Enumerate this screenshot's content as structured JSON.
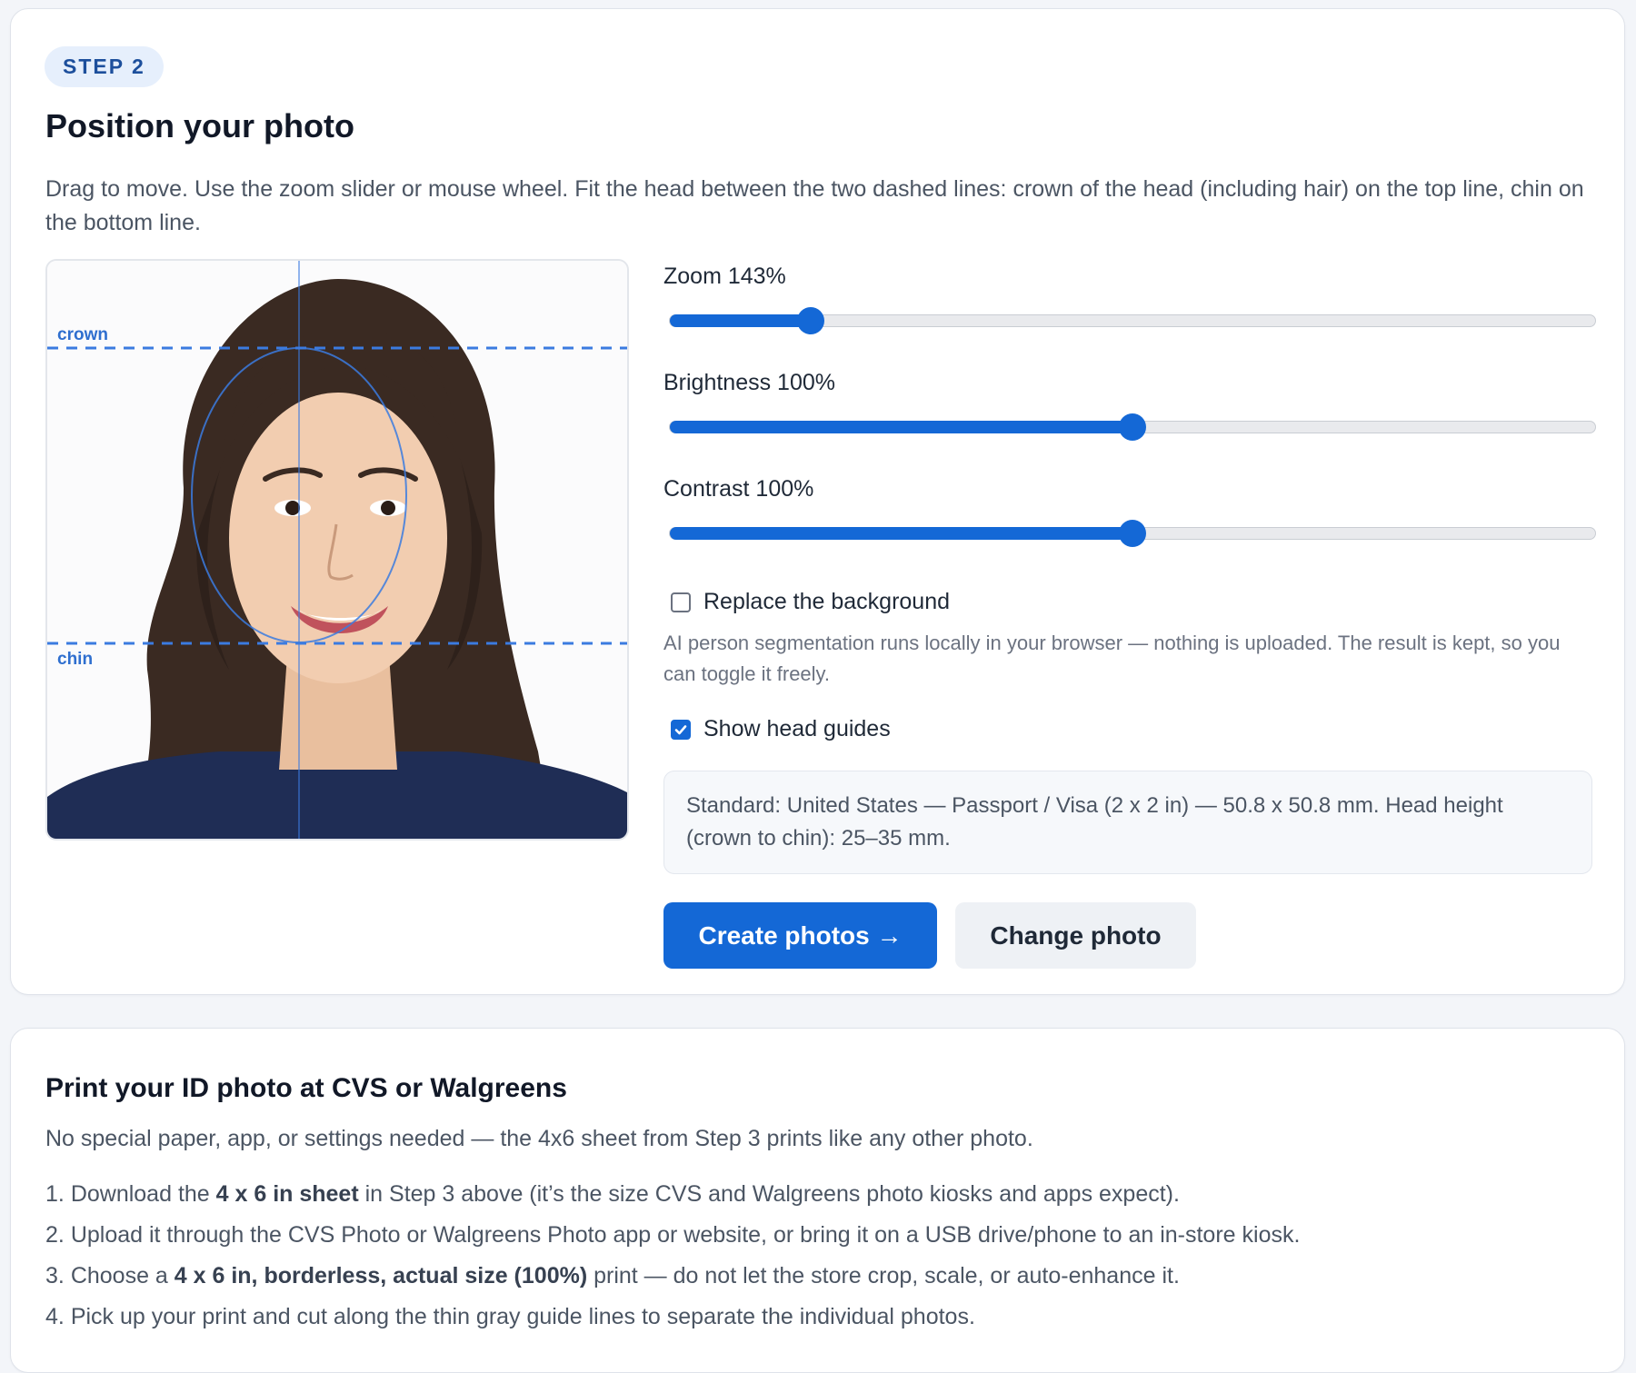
{
  "step_badge": "STEP 2",
  "title": "Position your photo",
  "instructions": "Drag to move. Use the zoom slider or mouse wheel. Fit the head between the two dashed lines: crown of the head (including hair) on the top line, chin on the bottom line.",
  "editor": {
    "crown_label": "crown",
    "chin_label": "chin"
  },
  "sliders": [
    {
      "label": "Zoom 143%",
      "fraction": 0.152
    },
    {
      "label": "Brightness 100%",
      "fraction": 0.5
    },
    {
      "label": "Contrast 100%",
      "fraction": 0.5
    }
  ],
  "replace_background": {
    "label": "Replace the background",
    "checked": false,
    "note": "AI person segmentation runs locally in your browser — nothing is uploaded. The result is kept, so you can toggle it freely."
  },
  "show_guides": {
    "label": "Show head guides",
    "checked": true
  },
  "standard_info": "Standard: United States — Passport / Visa (2 x 2 in) — 50.8 x 50.8 mm. Head height (crown to chin): 25–35 mm.",
  "buttons": {
    "create": "Create photos →",
    "change": "Change photo"
  },
  "print_section": {
    "title": "Print your ID photo at CVS or Walgreens",
    "intro": "No special paper, app, or settings needed — the 4x6 sheet from Step 3 prints like any other photo.",
    "steps": [
      {
        "num": "1.",
        "before": "Download the ",
        "bold": "4 x 6 in sheet",
        "after": " in Step 3 above (it’s the size CVS and Walgreens photo kiosks and apps expect)."
      },
      {
        "num": "2.",
        "before": "Upload it through the CVS Photo or Walgreens Photo app or website, or bring it on a USB drive/phone to an in-store kiosk.",
        "bold": "",
        "after": ""
      },
      {
        "num": "3.",
        "before": "Choose a ",
        "bold": "4 x 6 in, borderless, actual size (100%)",
        "after": " print — do not let the store crop, scale, or auto-enhance it."
      },
      {
        "num": "4.",
        "before": "Pick up your print and cut along the thin gray guide lines to separate the individual photos.",
        "bold": "",
        "after": ""
      }
    ]
  },
  "colors": {
    "accent": "#1468d6",
    "guide": "#3b7be0",
    "badge_bg": "#e6effc",
    "badge_text": "#1d4f9c"
  }
}
